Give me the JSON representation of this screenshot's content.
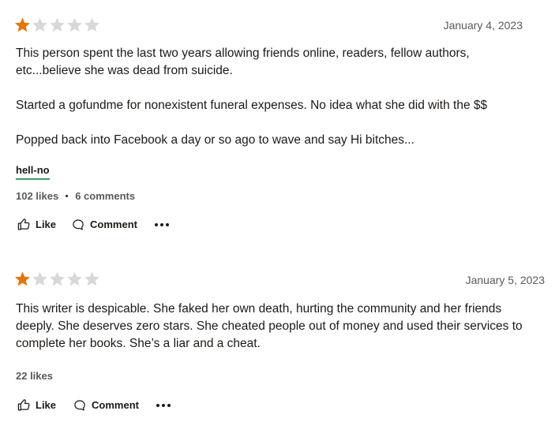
{
  "reviews": [
    {
      "rating": 1,
      "max_rating": 5,
      "date": "January 4, 2023",
      "paragraphs": [
        "This person spent the last two years allowing friends online, readers, fellow authors, etc...believe she was dead from suicide.",
        "Started a gofundme for nonexistent funeral expenses. No idea what she did with the $$",
        "Popped back into Facebook a day or so ago to wave and say Hi bitches..."
      ],
      "shelf_tag": "hell-no",
      "likes": "102 likes",
      "comments": "6 comments",
      "like_label": "Like",
      "comment_label": "Comment"
    },
    {
      "rating": 1,
      "max_rating": 5,
      "date": "January 5, 2023",
      "paragraphs": [
        "This writer is despicable. She faked her own death, hurting the community and her friends deeply. She deserves zero stars. She cheated people out of money and used their services to complete her books. She’s a liar and a cheat."
      ],
      "likes": "22 likes",
      "like_label": "Like",
      "comment_label": "Comment"
    }
  ],
  "colors": {
    "star_filled": "#e87400",
    "star_empty": "#d8d8d8",
    "tag_underline": "#409d69",
    "text": "#1e1915",
    "muted": "#595959"
  },
  "icons": [
    "star-icon",
    "thumbs-up-icon",
    "comment-icon",
    "more-icon"
  ]
}
